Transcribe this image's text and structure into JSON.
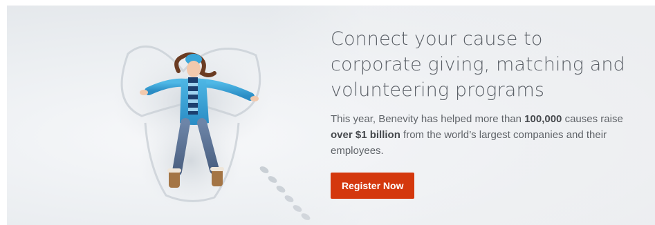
{
  "hero": {
    "headline": "Connect your cause to corporate giving, matching and volunteering programs",
    "body": {
      "part1": "This year, Benevity has helped more than ",
      "bold1": "100,000",
      "part2": " causes raise ",
      "bold2": "over $1 billion",
      "part3": " from the world’s largest companies and their employees."
    },
    "cta_label": "Register Now",
    "colors": {
      "cta_background": "#d4380d",
      "headline": "#5a5f66",
      "body": "#5f6368"
    }
  }
}
